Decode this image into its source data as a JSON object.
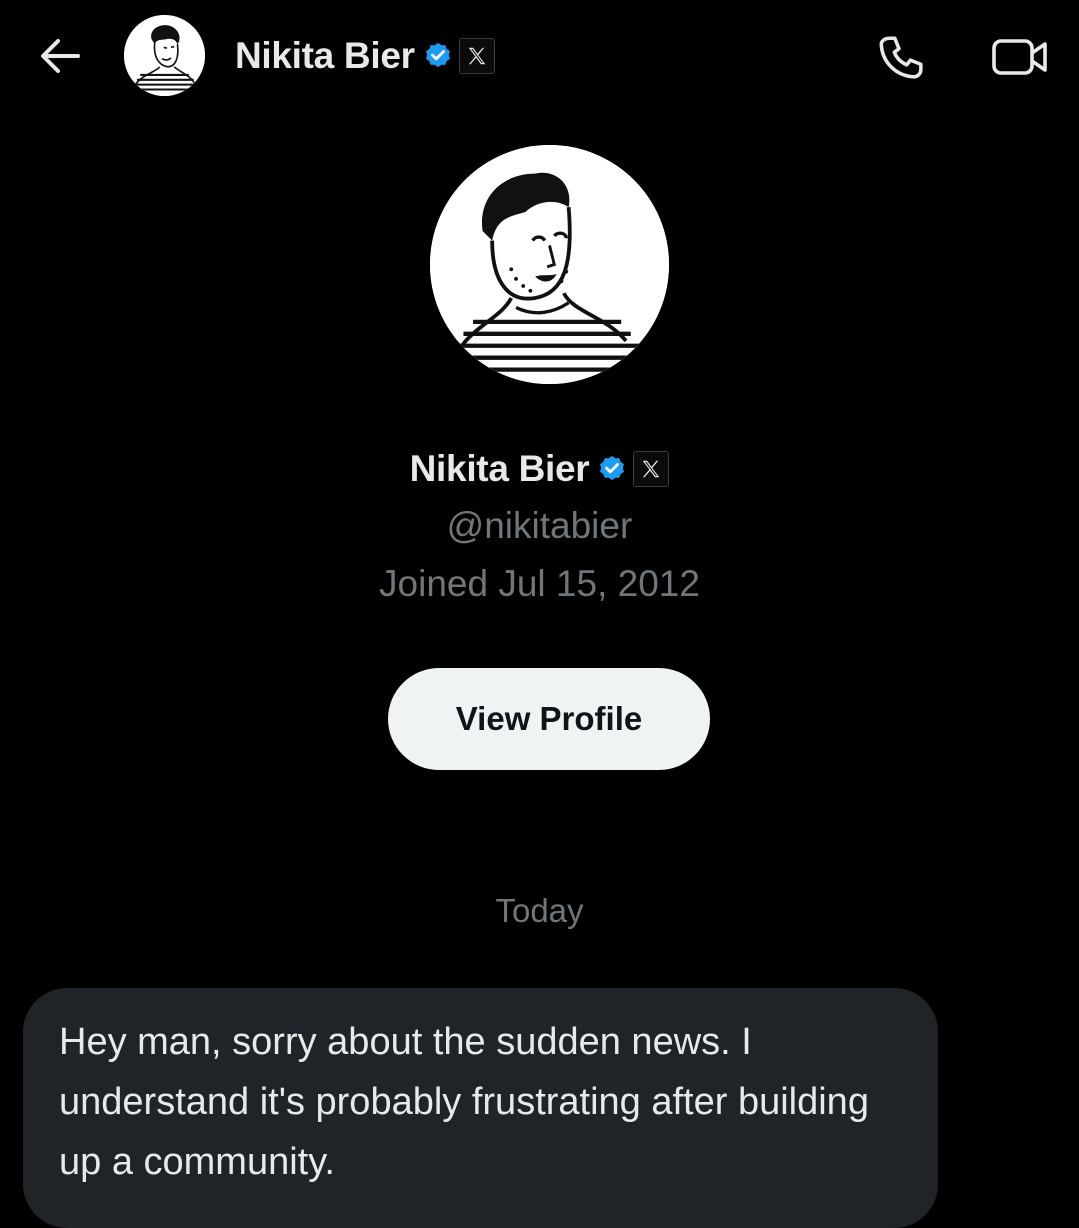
{
  "header": {
    "name": "Nikita Bier",
    "icons": {
      "back": "arrow-left-icon",
      "verified": "verified-badge-icon",
      "affiliate": "x-logo-icon",
      "call": "phone-icon",
      "video": "video-camera-icon"
    }
  },
  "profile": {
    "name": "Nikita Bier",
    "handle": "@nikitabier",
    "joined": "Joined Jul 15, 2012",
    "view_profile_label": "View Profile"
  },
  "conversation": {
    "date_separator": "Today",
    "messages": [
      {
        "text": "Hey man, sorry about the sudden news. I understand it's probably frustrating after building up a community."
      }
    ]
  },
  "colors": {
    "background": "#000000",
    "text_primary": "#e7e9ea",
    "text_secondary": "#71767b",
    "verified_blue": "#1d9bf0",
    "button_bg": "#eff3f4",
    "bubble_bg": "#202327"
  }
}
